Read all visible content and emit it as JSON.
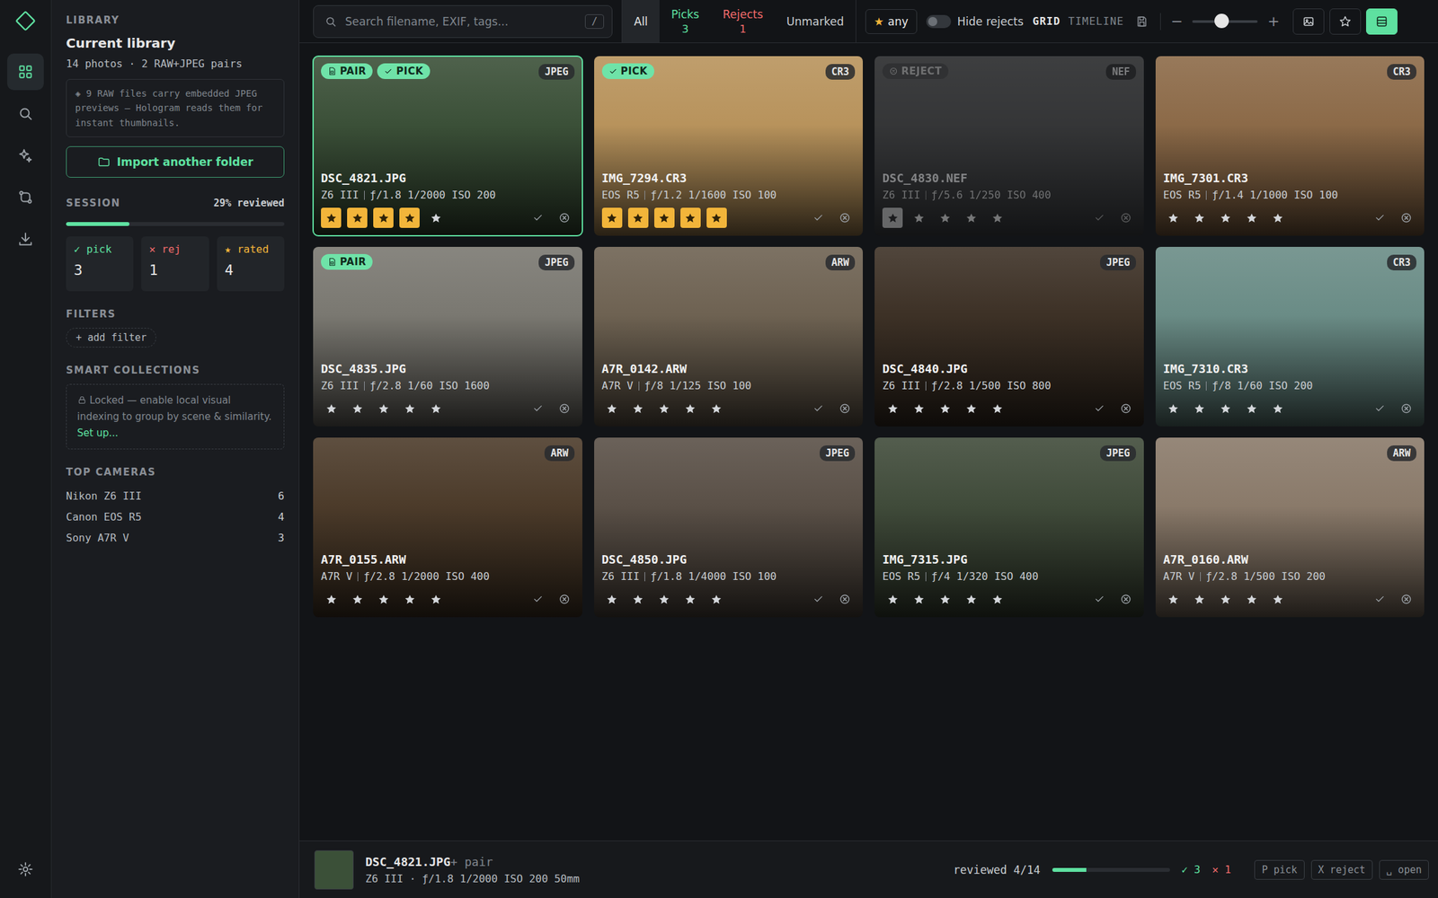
{
  "rail": {
    "items": [
      {
        "selected": true
      },
      {
        "selected": false
      },
      {
        "selected": false
      },
      {
        "selected": false
      },
      {
        "selected": false
      }
    ],
    "settings": {
      "selected": false
    }
  },
  "sidebar": {
    "section": "LIBRARY",
    "title": "Current library",
    "meta": "14 photos · 2 RAW+JPEG pairs",
    "note": "◈ 9 RAW files carry embedded JPEG previews — Hologram reads them for instant thumbnails.",
    "import_button": "Import another folder",
    "session": {
      "label": "SESSION",
      "reading": "29% reviewed",
      "level": 0.29
    },
    "stats": [
      {
        "icon": "✓",
        "label": "pick",
        "value": "3",
        "color": "#5ee0a0"
      },
      {
        "icon": "✕",
        "label": "rej",
        "value": "1",
        "color": "#f06b6b"
      },
      {
        "icon": "★",
        "label": "rated",
        "value": "4",
        "color": "#f2b53a"
      }
    ],
    "filters": {
      "label": "FILTERS",
      "add": "+ add filter"
    },
    "smart": {
      "label": "SMART COLLECTIONS",
      "text": "Locked — enable local visual indexing to group by scene & similarity.",
      "link": "Set up..."
    },
    "cameras": {
      "label": "TOP CAMERAS",
      "items": [
        {
          "name": "Nikon Z6 III",
          "count": "6"
        },
        {
          "name": "Canon EOS R5",
          "count": "4"
        },
        {
          "name": "Sony A7R V",
          "count": "3"
        }
      ]
    }
  },
  "toolbar": {
    "search": {
      "placeholder": "Search filename, EXIF, tags...",
      "shortcut": "/"
    },
    "tabs": [
      {
        "label": "All",
        "count": "",
        "selected": true,
        "color": "#e6e6e6"
      },
      {
        "label": "Picks",
        "count": "3",
        "selected": false,
        "color": "#5ee0a0"
      },
      {
        "label": "Rejects",
        "count": "1",
        "selected": false,
        "color": "#f06b6b"
      },
      {
        "label": "Unmarked",
        "count": "",
        "selected": false,
        "color": "#c8ccd0"
      }
    ],
    "rating_filter": {
      "icon": "★",
      "label": "any"
    },
    "toggle": {
      "label": "Hide rejects",
      "on": false
    },
    "views": [
      {
        "label": "GRID",
        "selected": true
      },
      {
        "label": "TIMELINE",
        "selected": false
      }
    ],
    "zoom": {
      "minus": "−",
      "plus": "+",
      "level": 0.45
    },
    "modes": [
      {
        "selected": false
      },
      {
        "selected": false
      },
      {
        "selected": true
      }
    ]
  },
  "photos": [
    {
      "name": "DSC_4821.JPG",
      "camera": "Z6 III",
      "exposure": "ƒ/1.8 1/2000 ISO 200",
      "format": "JPEG",
      "badges": [
        {
          "label": "PAIR",
          "kind": "pair"
        },
        {
          "label": "PICK",
          "kind": "pick"
        }
      ],
      "rejected": false,
      "stars": 4,
      "selected": true,
      "color": "#3b5038"
    },
    {
      "name": "IMG_7294.CR3",
      "camera": "EOS R5",
      "exposure": "ƒ/1.2 1/1600 ISO 100",
      "format": "CR3",
      "badges": [
        {
          "label": "PICK",
          "kind": "pick"
        }
      ],
      "rejected": false,
      "stars": 5,
      "selected": false,
      "color": "#b8935c"
    },
    {
      "name": "DSC_4830.NEF",
      "camera": "Z6 III",
      "exposure": "ƒ/5.6 1/250 ISO 400",
      "format": "NEF",
      "badges": [
        {
          "label": "REJECT",
          "kind": "reject"
        }
      ],
      "rejected": true,
      "stars": 1,
      "selected": false,
      "color": "#55595c"
    },
    {
      "name": "IMG_7301.CR3",
      "camera": "EOS R5",
      "exposure": "ƒ/1.4 1/1000 ISO 100",
      "format": "CR3",
      "badges": [],
      "rejected": false,
      "stars": 0,
      "selected": false,
      "color": "#8c6a48"
    },
    {
      "name": "DSC_4835.JPG",
      "camera": "Z6 III",
      "exposure": "ƒ/2.8 1/60 ISO 1600",
      "format": "JPEG",
      "badges": [
        {
          "label": "PAIR",
          "kind": "pair"
        }
      ],
      "rejected": false,
      "stars": 0,
      "selected": false,
      "color": "#7a7871"
    },
    {
      "name": "A7R_0142.ARW",
      "camera": "A7R V",
      "exposure": "ƒ/8 1/125 ISO 100",
      "format": "ARW",
      "badges": [],
      "rejected": false,
      "stars": 0,
      "selected": false,
      "color": "#6e6252"
    },
    {
      "name": "DSC_4840.JPG",
      "camera": "Z6 III",
      "exposure": "ƒ/2.8 1/500 ISO 800",
      "format": "JPEG",
      "badges": [],
      "rejected": false,
      "stars": 0,
      "selected": false,
      "color": "#3d3126"
    },
    {
      "name": "IMG_7310.CR3",
      "camera": "EOS R5",
      "exposure": "ƒ/8 1/60 ISO 200",
      "format": "CR3",
      "badges": [],
      "rejected": false,
      "stars": 0,
      "selected": false,
      "color": "#6a8c86"
    },
    {
      "name": "A7R_0155.ARW",
      "camera": "A7R V",
      "exposure": "ƒ/2.8 1/2000 ISO 400",
      "format": "ARW",
      "badges": [],
      "rejected": false,
      "stars": 0,
      "selected": false,
      "color": "#4c3b2a"
    },
    {
      "name": "DSC_4850.JPG",
      "camera": "Z6 III",
      "exposure": "ƒ/1.8 1/4000 ISO 100",
      "format": "JPEG",
      "badges": [],
      "rejected": false,
      "stars": 0,
      "selected": false,
      "color": "#5a5047"
    },
    {
      "name": "IMG_7315.JPG",
      "camera": "EOS R5",
      "exposure": "ƒ/4 1/320 ISO 400",
      "format": "JPEG",
      "badges": [],
      "rejected": false,
      "stars": 0,
      "selected": false,
      "color": "#404b3a"
    },
    {
      "name": "A7R_0160.ARW",
      "camera": "A7R V",
      "exposure": "ƒ/2.8 1/500 ISO 200",
      "format": "ARW",
      "badges": [],
      "rejected": false,
      "stars": 0,
      "selected": false,
      "color": "#8a7a6a"
    }
  ],
  "status_bar": {
    "thumb_color": "#3b5038",
    "name": "DSC_4821.JPG",
    "suffix": "+ pair",
    "meta": "Z6 III · ƒ/1.8 1/2000 ISO 200 50mm",
    "reviewed": "reviewed 4/14",
    "level": 0.29,
    "picks": "✓ 3",
    "rejects": "✕ 1",
    "keys": [
      "P pick",
      "X reject",
      "␣ open"
    ]
  }
}
